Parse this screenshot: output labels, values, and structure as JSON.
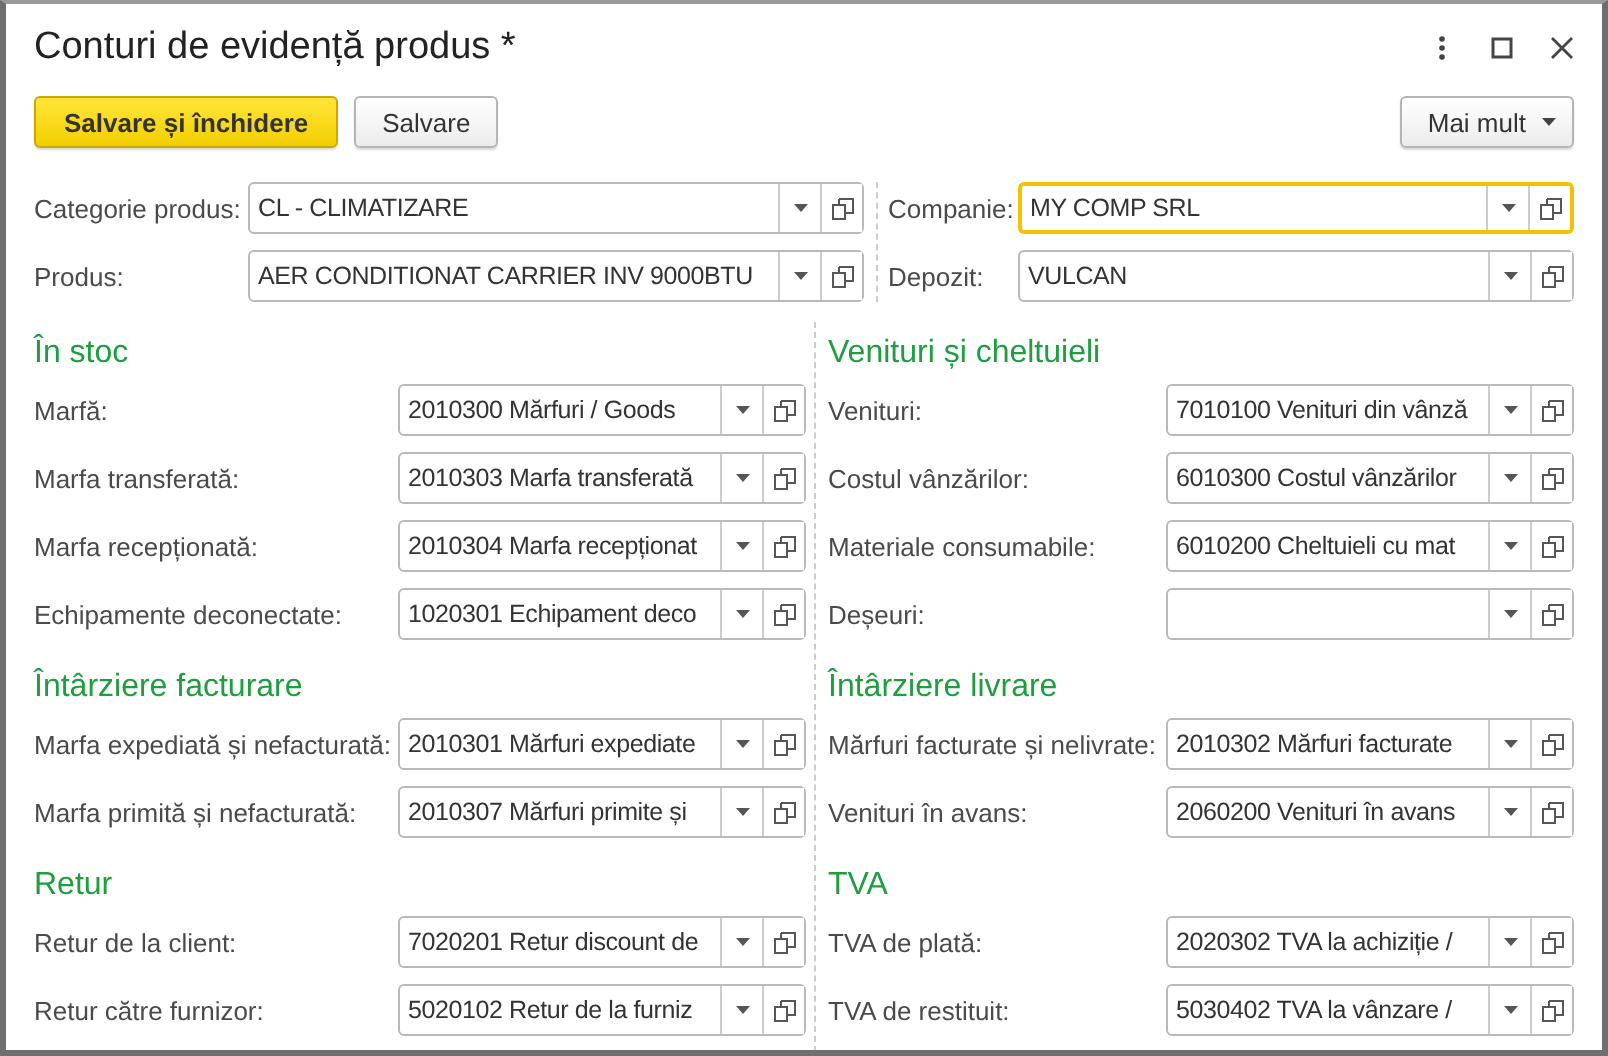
{
  "window": {
    "title": "Conturi de evidență produs *"
  },
  "buttons": [
    {
      "label": "Salvare și închidere",
      "kind": "primary"
    },
    {
      "label": "Salvare",
      "kind": "default"
    },
    {
      "label": "Mai mult",
      "kind": "menu"
    }
  ],
  "top_fields_left": [
    {
      "label": "Categorie produs:",
      "value": "CL - CLIMATIZARE",
      "focused": false
    },
    {
      "label": "Produs:",
      "value": "AER CONDITIONAT CARRIER INV 9000BTU",
      "focused": false
    }
  ],
  "top_fields_right": [
    {
      "label": "Companie:",
      "value": "MY COMP SRL",
      "focused": true
    },
    {
      "label": "Depozit:",
      "value": "VULCAN",
      "focused": false
    }
  ],
  "sections_left": [
    {
      "title": "În stoc",
      "fields": [
        {
          "label": "Marfă:",
          "value": "2010300 Mărfuri / Goods"
        },
        {
          "label": "Marfa transferată:",
          "value": "2010303 Marfa transferată"
        },
        {
          "label": "Marfa recepționată:",
          "value": "2010304 Marfa recepționat"
        },
        {
          "label": "Echipamente deconectate:",
          "value": "1020301 Echipament deco"
        }
      ]
    },
    {
      "title": "Întârziere facturare",
      "fields": [
        {
          "label": "Marfa expediată și nefacturată:",
          "value": "2010301 Mărfuri expediate"
        },
        {
          "label": "Marfa primită și nefacturată:",
          "value": "2010307 Mărfuri primite și"
        }
      ]
    },
    {
      "title": "Retur",
      "fields": [
        {
          "label": "Retur de la client:",
          "value": "7020201 Retur discount de"
        },
        {
          "label": "Retur către furnizor:",
          "value": "5020102 Retur de la furniz"
        }
      ]
    }
  ],
  "sections_right": [
    {
      "title": "Venituri și cheltuieli",
      "fields": [
        {
          "label": "Venituri:",
          "value": "7010100 Venituri din vânză"
        },
        {
          "label": "Costul vânzărilor:",
          "value": "6010300 Costul vânzărilor"
        },
        {
          "label": "Materiale consumabile:",
          "value": "6010200 Cheltuieli cu mat"
        },
        {
          "label": "Deșeuri:"
        }
      ]
    },
    {
      "title": "Întârziere livrare",
      "fields": [
        {
          "label": "Mărfuri facturate și nelivrate:",
          "value": "2010302 Mărfuri facturate"
        },
        {
          "label": "Venituri în avans:",
          "value": "2060200 Venituri în avans"
        }
      ]
    },
    {
      "title": "TVA",
      "fields": [
        {
          "label": "TVA de plată:",
          "value": "2020302 TVA la achiziție /"
        },
        {
          "label": "TVA de restituit:",
          "value": "5030402 TVA la vânzare /"
        }
      ]
    }
  ]
}
